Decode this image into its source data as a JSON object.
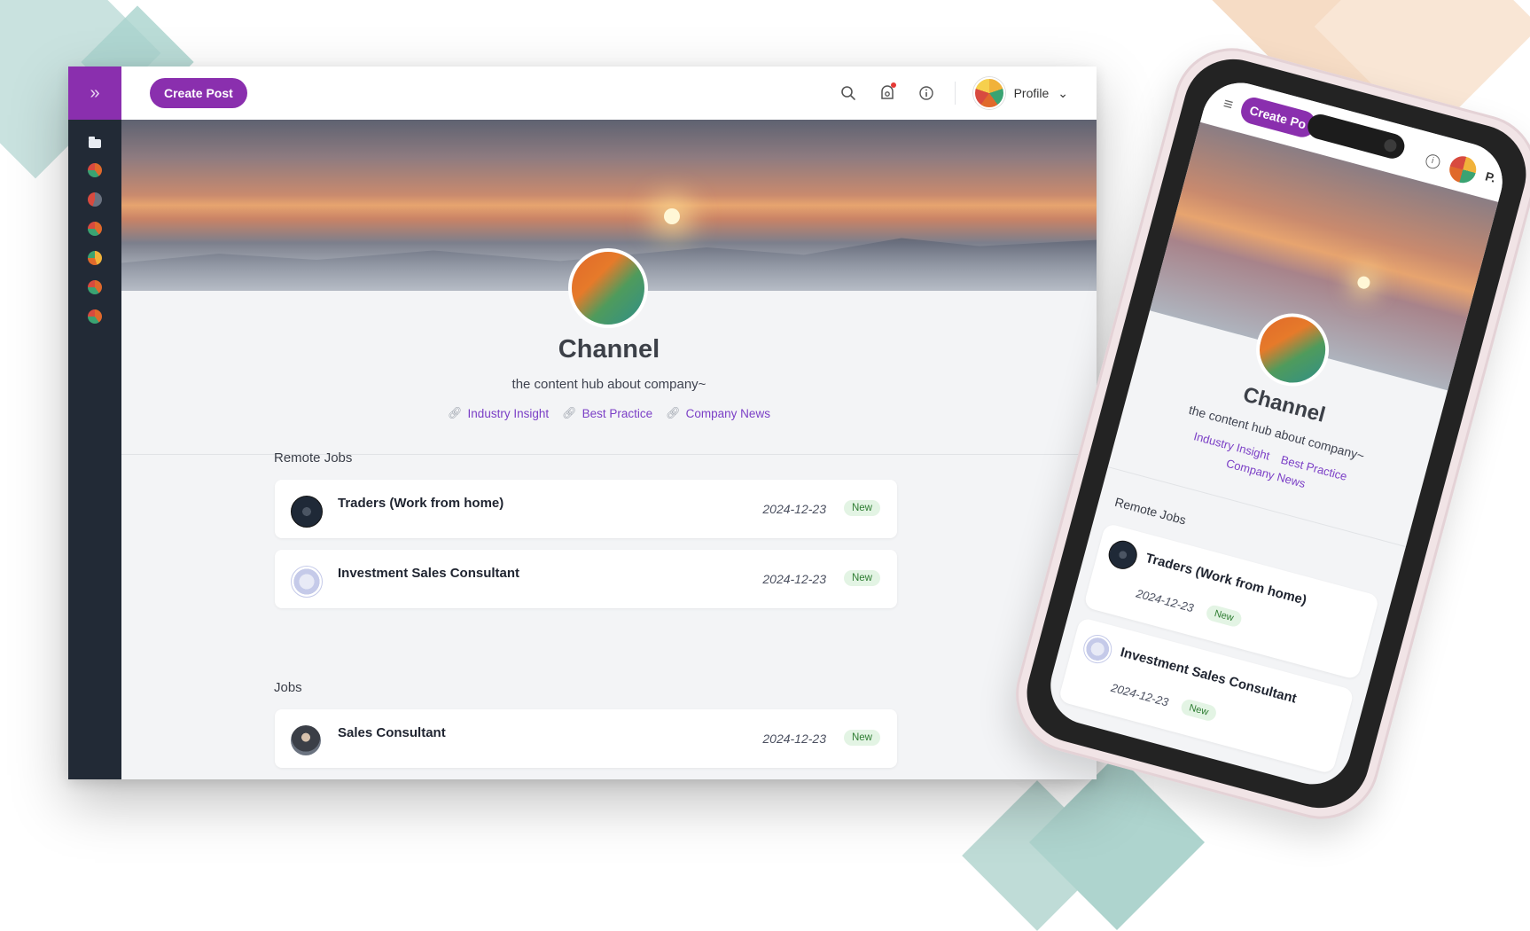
{
  "desktop": {
    "topbar": {
      "create_label": "Create Post",
      "profile_label": "Profile",
      "profile_caret": "⌄",
      "expand_glyph": "»"
    },
    "channel": {
      "title": "Channel",
      "subtitle": "the content hub about company~",
      "links": [
        "Industry Insight",
        "Best Practice",
        "Company News"
      ]
    },
    "sections": [
      {
        "label": "Remote Jobs",
        "jobs": [
          {
            "title": "Traders (Work from home)",
            "date": "2024-12-23",
            "badge": "New",
            "logo": "dark"
          },
          {
            "title": "Investment Sales Consultant",
            "date": "2024-12-23",
            "badge": "New",
            "logo": "light"
          }
        ]
      },
      {
        "label": "Jobs",
        "jobs": [
          {
            "title": "Sales Consultant",
            "date": "2024-12-23",
            "badge": "New",
            "logo": "photo"
          }
        ]
      }
    ],
    "icons": {
      "search": "search-icon",
      "notifications": "notification-icon",
      "info": "info-icon",
      "link": "link-icon"
    }
  },
  "mobile": {
    "create_label": "Create Po",
    "menu_glyph": "≡",
    "info_glyph": "i",
    "profile_label": "P.",
    "channel": {
      "title": "Channel",
      "subtitle": "the content hub about company~",
      "links": [
        "Industry Insight",
        "Best Practice",
        "Company News"
      ]
    },
    "section_label": "Remote Jobs",
    "jobs": [
      {
        "title": "Traders (Work from home)",
        "date": "2024-12-23",
        "badge": "New",
        "logo": "dark"
      },
      {
        "title": "Investment Sales Consultant",
        "date": "2024-12-23",
        "badge": "New",
        "logo": "light"
      }
    ]
  },
  "colors": {
    "accent": "#8a2fae",
    "sidebar": "#222a36",
    "link": "#7b3fc6",
    "badge_bg": "#e3f4e4",
    "badge_text": "#2e7d32"
  }
}
